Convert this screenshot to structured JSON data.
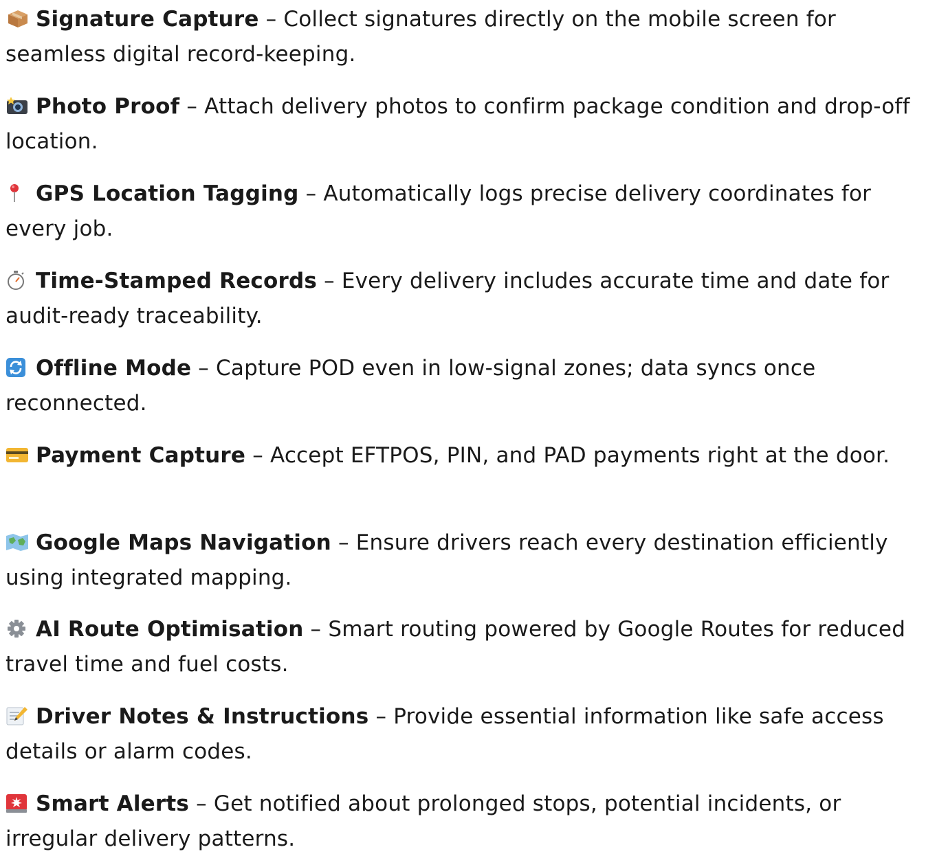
{
  "features": [
    {
      "icon": "package-icon",
      "title": "Signature Capture",
      "separator": " – ",
      "description": "Collect signatures directly on the mobile screen for seamless digital record-keeping."
    },
    {
      "icon": "camera-flash-icon",
      "title": "Photo Proof",
      "separator": " – ",
      "description": "Attach delivery photos to confirm package condition and drop-off location."
    },
    {
      "icon": "pin-icon",
      "title": "GPS Location Tagging",
      "separator": " – ",
      "description": "Automatically logs precise delivery coordinates for every job."
    },
    {
      "icon": "stopwatch-icon",
      "title": "Time-Stamped Records",
      "separator": " – ",
      "description": "Every delivery includes accurate time and date for audit-ready traceability."
    },
    {
      "icon": "sync-icon",
      "title": "Offline Mode",
      "separator": " – ",
      "description": "Capture POD even in low-signal zones; data syncs once reconnected."
    },
    {
      "icon": "credit-card-icon",
      "title": "Payment Capture",
      "separator": " – ",
      "description": "Accept EFTPOS, PIN, and PAD payments right at the door."
    },
    {
      "icon": "map-icon",
      "title": "Google Maps Navigation",
      "separator": " – ",
      "description": "Ensure drivers reach every destination efficiently using integrated mapping."
    },
    {
      "icon": "gear-icon",
      "title": "AI Route Optimisation",
      "separator": " – ",
      "description": "Smart routing powered by Google Routes for reduced travel time and fuel costs."
    },
    {
      "icon": "memo-icon",
      "title": "Driver Notes & Instructions",
      "separator": " – ",
      "description": "Provide essential information like safe access details or alarm codes."
    },
    {
      "icon": "alert-light-icon",
      "title": "Smart Alerts",
      "separator": " – ",
      "description": "Get notified about prolonged stops, potential incidents, or irregular delivery patterns."
    }
  ]
}
